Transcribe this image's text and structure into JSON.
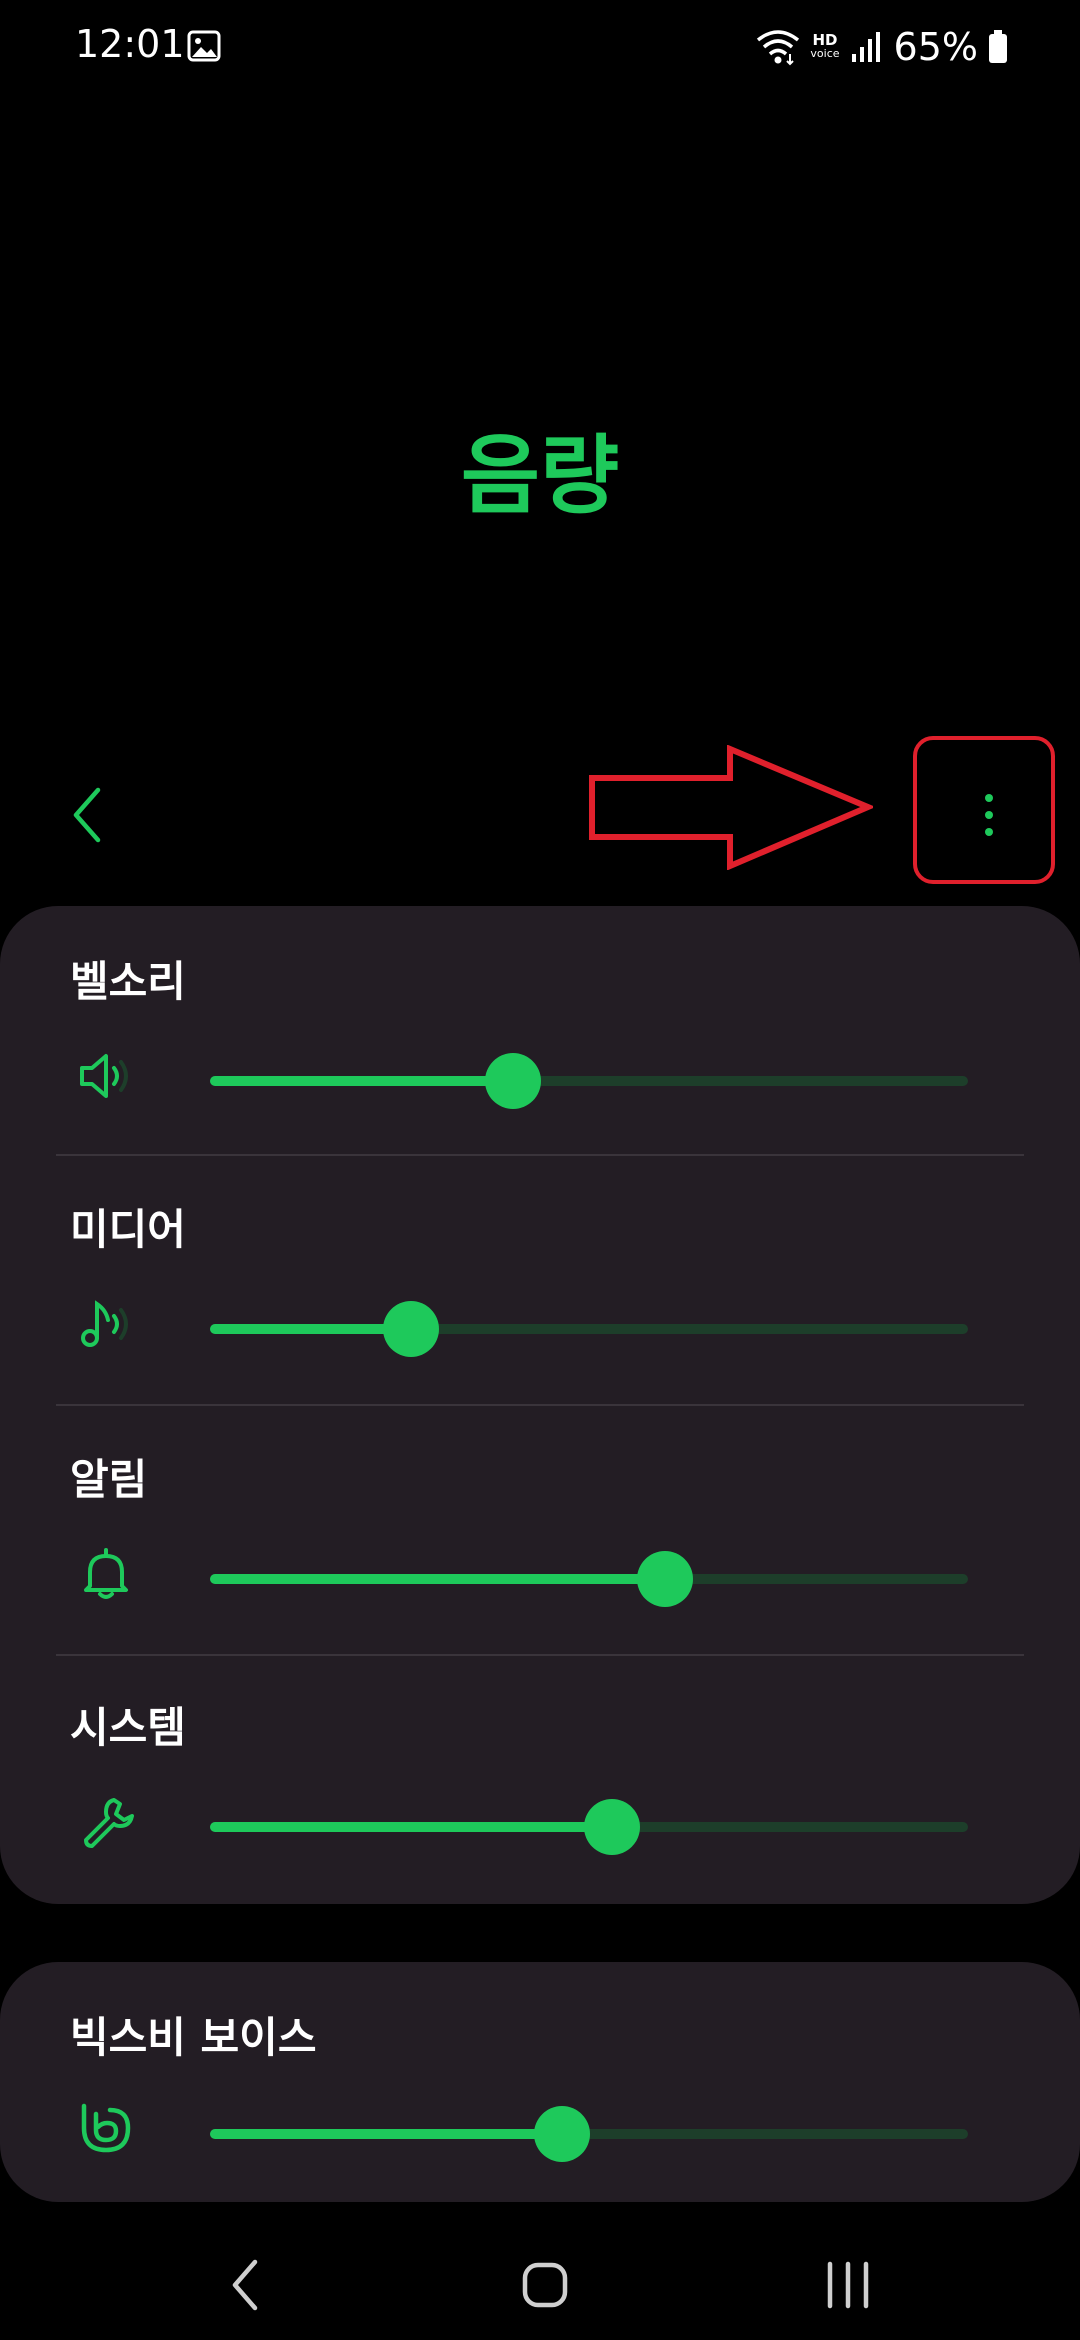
{
  "status_bar": {
    "time": "12:01",
    "hd_label": "HD",
    "voice_label": "voice",
    "battery_percent": "65%"
  },
  "page": {
    "title": "음량"
  },
  "colors": {
    "accent": "#1ec95b",
    "track_bg": "#1d3e2a",
    "card_bg": "#231d24",
    "highlight": "#e0202c"
  },
  "volumes": [
    {
      "label": "벨소리",
      "icon": "speaker-icon",
      "level": 0.4
    },
    {
      "label": "미디어",
      "icon": "music-note-icon",
      "level": 0.265
    },
    {
      "label": "알림",
      "icon": "bell-icon",
      "level": 0.6
    },
    {
      "label": "시스템",
      "icon": "wrench-icon",
      "level": 0.53
    }
  ],
  "bixby": {
    "label": "빅스비 보이스",
    "icon": "bixby-icon",
    "level": 0.465
  },
  "nav": {
    "back_icon": "nav-back-icon",
    "home_icon": "nav-home-icon",
    "recents_icon": "nav-recents-icon"
  }
}
